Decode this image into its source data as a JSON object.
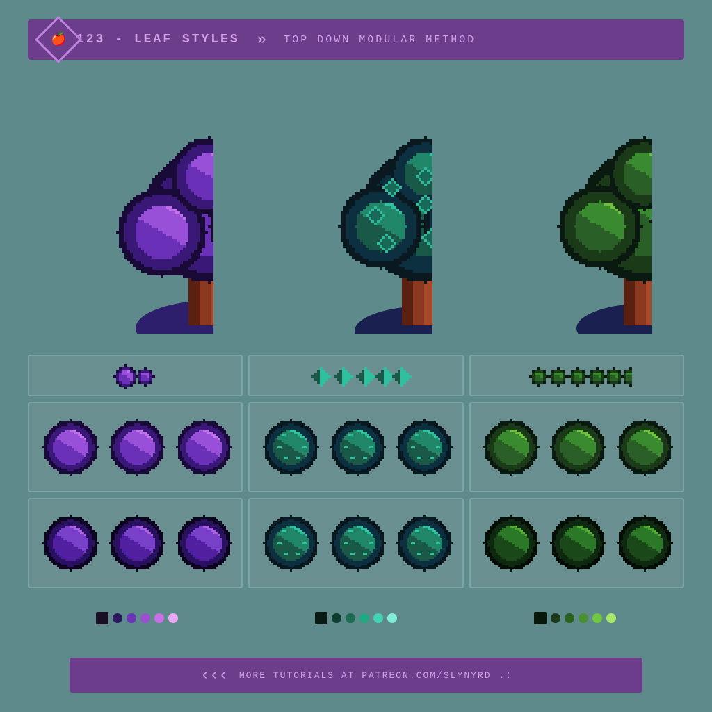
{
  "header": {
    "number": "123",
    "dash": "-",
    "title": "LEAF STYLES",
    "arrows": "»",
    "subtitle": "TOP DOWN MODULAR METHOD",
    "icon": "🍎"
  },
  "trees": [
    {
      "id": "tree-purple",
      "style": "bubble",
      "color": "purple"
    },
    {
      "id": "tree-teal",
      "style": "star",
      "color": "teal"
    },
    {
      "id": "tree-green",
      "style": "round",
      "color": "green"
    }
  ],
  "palettes": [
    {
      "colors": [
        "#1a1025",
        "#3d1f6b",
        "#6b35b8",
        "#a855d4",
        "#d070e8",
        "#e8a0f0"
      ]
    },
    {
      "colors": [
        "#0a1a1a",
        "#0d3d3a",
        "#1a6b5a",
        "#20a88a",
        "#40d4b8",
        "#80edd8"
      ]
    },
    {
      "colors": [
        "#0a1a0a",
        "#1a3d1a",
        "#2a6b2a",
        "#3a9a2a",
        "#6ac840",
        "#a0e860"
      ]
    }
  ],
  "footer": {
    "arrows_left": "(((",
    "text": "MORE TUTORIALS AT PATREON.COM/SLYNYRD",
    "dots": ".:"
  }
}
